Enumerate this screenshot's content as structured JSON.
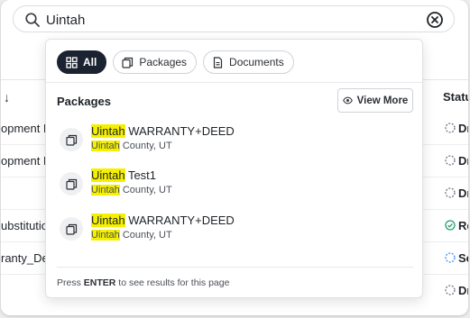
{
  "search": {
    "value": "Uintah",
    "placeholder": ""
  },
  "background_table": {
    "sort_arrow": "↓",
    "status_header": "Status",
    "rows": [
      {
        "name": "opment M",
        "status": "Dr",
        "status_icon": "dashed-circle-gray-icon"
      },
      {
        "name": "opment M",
        "status": "Dr",
        "status_icon": "dashed-circle-gray-icon"
      },
      {
        "name": "",
        "status": "Dr",
        "status_icon": "dashed-circle-gray-icon"
      },
      {
        "name": "ubstitutio",
        "status": "Re",
        "status_icon": "check-circle-green-icon"
      },
      {
        "name": "ranty_Dee",
        "status": "Se",
        "status_icon": "dashed-circle-blue-icon"
      },
      {
        "name": "",
        "status": "Dr",
        "status_icon": "dashed-circle-gray-icon"
      }
    ]
  },
  "dropdown": {
    "filters": [
      {
        "label": "All",
        "icon": "grid-icon",
        "active": true
      },
      {
        "label": "Packages",
        "icon": "packages-icon",
        "active": false
      },
      {
        "label": "Documents",
        "icon": "document-icon",
        "active": false
      }
    ],
    "section_title": "Packages",
    "view_more_label": "View More",
    "results": [
      {
        "highlight": "Uintah",
        "title_rest": " WARRANTY+DEED",
        "sub_highlight": "Uintah",
        "sub_rest": " County, UT"
      },
      {
        "highlight": "Uintah",
        "title_rest": " Test1",
        "sub_highlight": "Uintah",
        "sub_rest": " County, UT"
      },
      {
        "highlight": "Uintah",
        "title_rest": " WARRANTY+DEED",
        "sub_highlight": "Uintah",
        "sub_rest": " County, UT"
      }
    ],
    "footer": {
      "prefix": "Press ",
      "key": "ENTER",
      "suffix": " to see results for this page"
    }
  },
  "colors": {
    "highlight": "#f5f000",
    "active_chip": "#1b2230",
    "status_green": "#22a06b",
    "status_blue": "#3d8bfd",
    "status_gray": "#6b7280"
  }
}
